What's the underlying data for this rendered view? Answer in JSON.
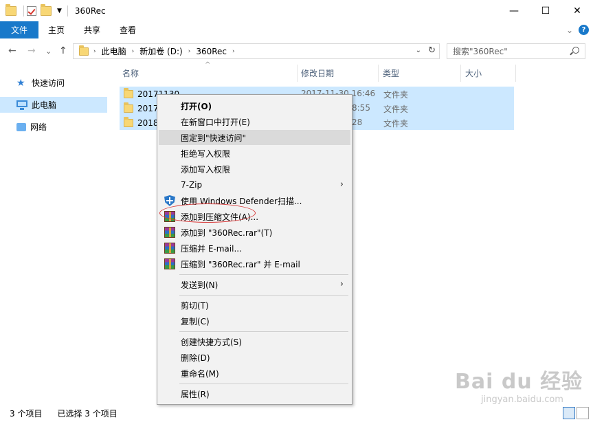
{
  "window": {
    "title": "360Rec",
    "controls": {
      "minimize": "—",
      "maximize": "☐",
      "close": "✕"
    }
  },
  "ribbon": {
    "tabs": [
      {
        "label": "文件"
      },
      {
        "label": "主页"
      },
      {
        "label": "共享"
      },
      {
        "label": "查看"
      }
    ],
    "collapse_chevron": "⌄",
    "help": "?"
  },
  "nav": {
    "back": "←",
    "forward": "→",
    "recent": "⌄",
    "up": "↑"
  },
  "address": {
    "crumbs": [
      "此电脑",
      "新加卷 (D:)",
      "360Rec"
    ],
    "separator": "›",
    "dropdown": "⌄",
    "refresh": "↻"
  },
  "search": {
    "placeholder": "搜索\"360Rec\""
  },
  "sidebar": {
    "items": [
      {
        "label": "快速访问",
        "icon": "star-icon"
      },
      {
        "label": "此电脑",
        "icon": "computer-icon"
      },
      {
        "label": "网络",
        "icon": "network-icon"
      }
    ]
  },
  "columns": {
    "name": "名称",
    "modified": "修改日期",
    "type": "类型",
    "size": "大小"
  },
  "files": [
    {
      "name": "20171130",
      "modified": "2017-11-30 16:46",
      "type": "文件夹"
    },
    {
      "name": "20171",
      "modified": "8:55",
      "type": "文件夹"
    },
    {
      "name": "2018",
      "modified": "28",
      "type": "文件夹"
    }
  ],
  "context_menu": {
    "items": [
      {
        "label": "打开(O)"
      },
      {
        "label": "在新窗口中打开(E)"
      },
      {
        "label": "固定到\"快速访问\""
      },
      {
        "label": "拒绝写入权限"
      },
      {
        "label": "添加写入权限"
      },
      {
        "label": "7-Zip"
      },
      {
        "label": "使用 Windows Defender扫描..."
      },
      {
        "label": "添加到压缩文件(A)..."
      },
      {
        "label": "添加到 \"360Rec.rar\"(T)"
      },
      {
        "label": "压缩并 E-mail..."
      },
      {
        "label": "压缩到 \"360Rec.rar\" 并 E-mail"
      },
      {
        "label": "发送到(N)"
      },
      {
        "label": "剪切(T)"
      },
      {
        "label": "复制(C)"
      },
      {
        "label": "创建快捷方式(S)"
      },
      {
        "label": "删除(D)"
      },
      {
        "label": "重命名(M)"
      },
      {
        "label": "属性(R)"
      }
    ],
    "submenu_arrow": "›"
  },
  "status": {
    "item_count": "3 个项目",
    "selected": "已选择 3 个项目"
  },
  "watermark": {
    "main": "Bai du 经验",
    "sub": "jingyan.baidu.com"
  }
}
